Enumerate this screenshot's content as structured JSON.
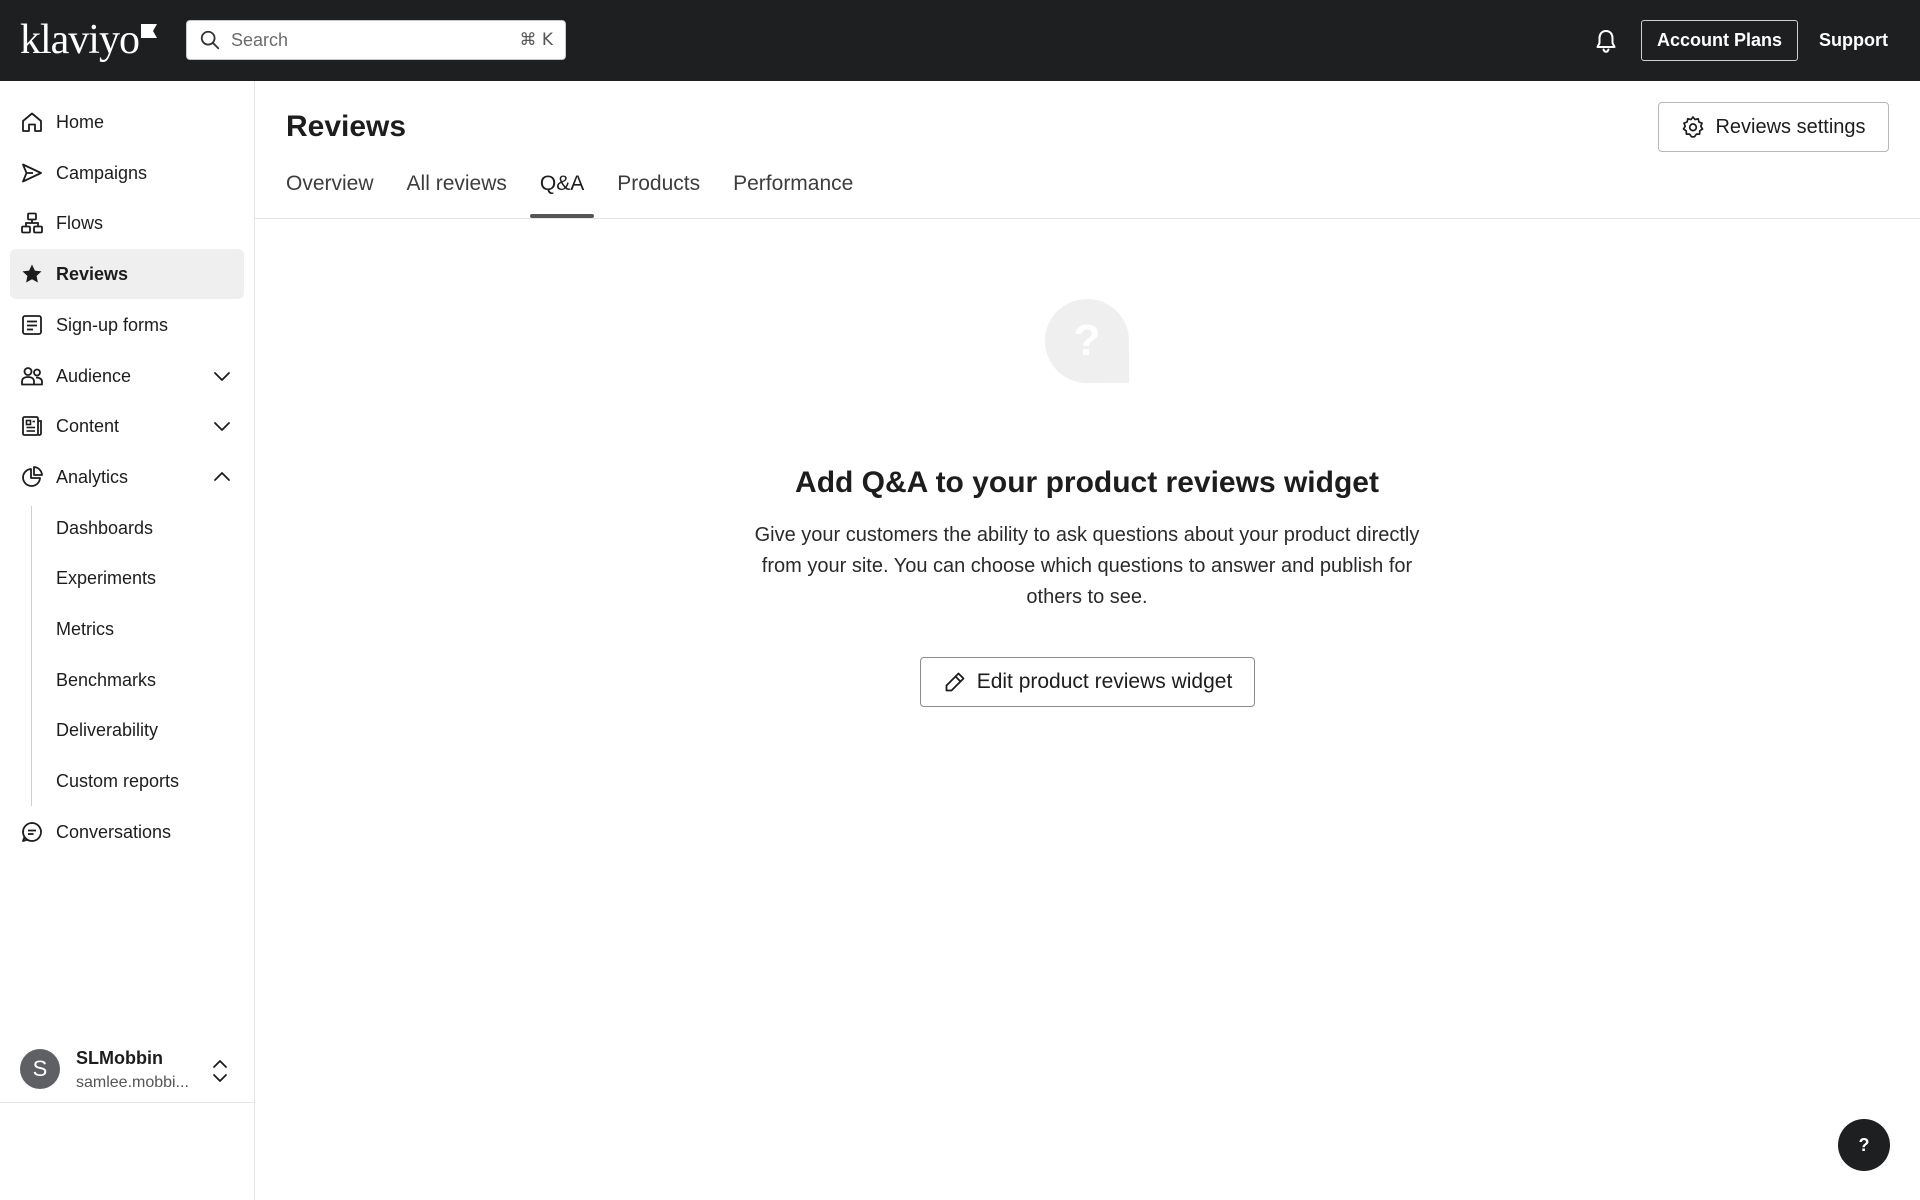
{
  "app": {
    "logo_text": "klaviyo",
    "search": {
      "placeholder": "Search",
      "shortcut": "⌘ K"
    },
    "account_plans_label": "Account Plans",
    "support_label": "Support"
  },
  "sidebar": {
    "items": [
      {
        "label": "Home",
        "icon": "home-icon"
      },
      {
        "label": "Campaigns",
        "icon": "send-icon"
      },
      {
        "label": "Flows",
        "icon": "flows-icon"
      },
      {
        "label": "Reviews",
        "icon": "star-icon",
        "active": true
      },
      {
        "label": "Sign-up forms",
        "icon": "form-icon"
      },
      {
        "label": "Audience",
        "icon": "audience-icon",
        "expandable": "collapsed"
      },
      {
        "label": "Content",
        "icon": "content-icon",
        "expandable": "collapsed"
      },
      {
        "label": "Analytics",
        "icon": "analytics-icon",
        "expandable": "expanded"
      }
    ],
    "analytics_sub": [
      "Dashboards",
      "Experiments",
      "Metrics",
      "Benchmarks",
      "Deliverability",
      "Custom reports"
    ],
    "conversations_label": "Conversations",
    "user": {
      "initial": "S",
      "name": "SLMobbin",
      "email": "samlee.mobbi..."
    }
  },
  "main": {
    "title": "Reviews",
    "settings_label": "Reviews settings",
    "tabs": [
      {
        "label": "Overview"
      },
      {
        "label": "All reviews"
      },
      {
        "label": "Q&A",
        "active": true
      },
      {
        "label": "Products"
      },
      {
        "label": "Performance"
      }
    ],
    "empty_state": {
      "icon": "question-bubble-icon",
      "title": "Add Q&A to your product reviews widget",
      "description": "Give your customers the ability to ask questions about your product directly from your site. You can choose which questions to answer and publish for others to see.",
      "button_label": "Edit product reviews widget"
    }
  },
  "help_label": "?",
  "colors": {
    "topbar": "#1e1f21",
    "active_bg": "#efefef",
    "tab_indicator": "#555555"
  }
}
